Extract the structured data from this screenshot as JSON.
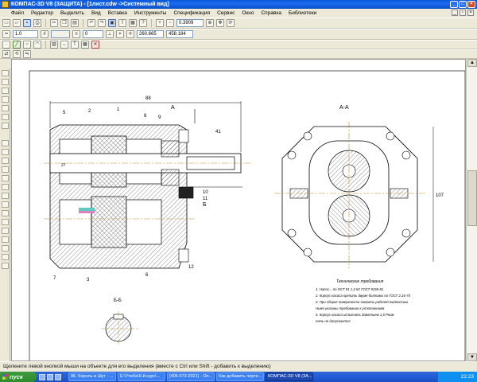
{
  "window": {
    "title": "КОМПАС-3D V8 (ЗАЩИТА) - [1лист.cdw ->Системный вид]"
  },
  "menu": [
    "Файл",
    "Редактор",
    "Выделить",
    "Вид",
    "Вставка",
    "Инструменты",
    "Спецификация",
    "Сервис",
    "Окно",
    "Справка",
    "Библиотеки"
  ],
  "toolbar": {
    "zoom": "0.3909",
    "coord_x": "260.665",
    "coord_y": "458.184",
    "line_scale": "1.0",
    "layer": "0"
  },
  "drawing": {
    "section_view_label": "A-A",
    "detail_label": "Б-Б",
    "notes_title": "Технические требования",
    "notes": [
      "1. Насос...  по ОСТ 91 1.2-81 ГОСТ 9150-81",
      "2. Корпус насоса крепить двумя болтами по ГОСТ 2.16-75",
      "3. При сборке поверхности смазать рабочей жидкостью",
      "Ниже указаны требования к уплотнениям",
      "4. Корпус насоса испытать давлением 1,5 Рном",
      "   течь не допускается"
    ],
    "dims": {
      "overall_len": "88",
      "d1": "41",
      "d2": "27",
      "flange": "107"
    },
    "part_numbers": [
      "5",
      "2",
      "1",
      "8",
      "9",
      "10",
      "11",
      "7",
      "3",
      "6",
      "12"
    ],
    "letter_A": "A",
    "letter_B": "Б"
  },
  "status": {
    "message": "Щелкните левой кнопкой мыши на объекте для его выделения (вместе с Ctrl или Shift - добавить к выделению)"
  },
  "taskbar": {
    "start": "пуск",
    "tasks": [
      "96. Король и Шут - ...",
      "E:\\Учеба\\5-й курс\\...",
      "[406-073-2021] - Оп...",
      "Как добавить черте...",
      "КОМПАС-3D V8 (ЗА..."
    ],
    "active_index": 4,
    "clock": "22:23"
  }
}
